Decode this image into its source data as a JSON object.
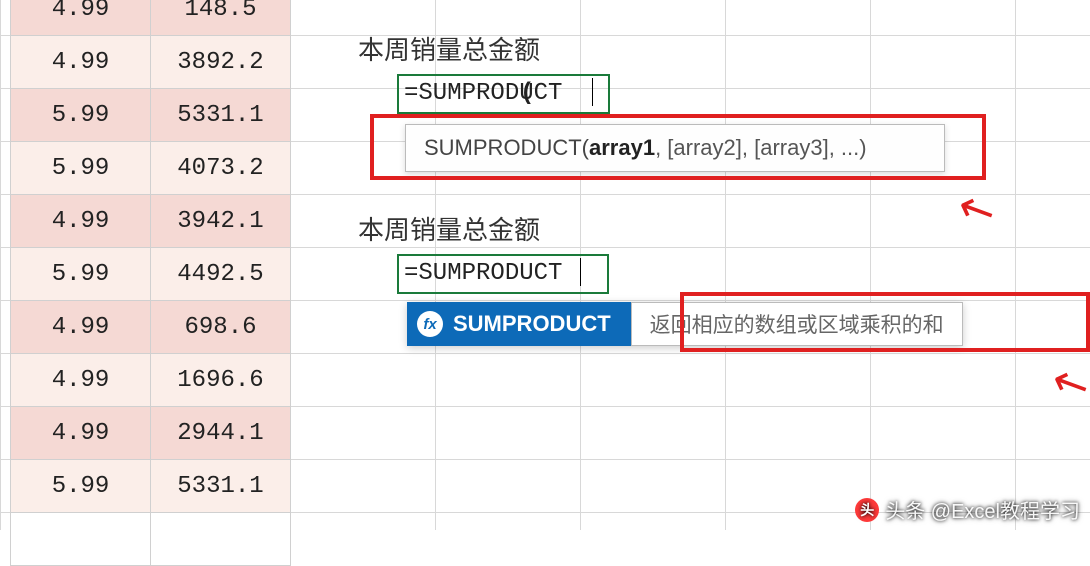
{
  "table": {
    "rows": [
      {
        "c1": "4.99",
        "c2": "148.5"
      },
      {
        "c1": "4.99",
        "c2": "3892.2"
      },
      {
        "c1": "5.99",
        "c2": "5331.1"
      },
      {
        "c1": "5.99",
        "c2": "4073.2"
      },
      {
        "c1": "4.99",
        "c2": "3942.1"
      },
      {
        "c1": "5.99",
        "c2": "4492.5"
      },
      {
        "c1": "4.99",
        "c2": "698.6"
      },
      {
        "c1": "4.99",
        "c2": "1696.6"
      },
      {
        "c1": "4.99",
        "c2": "2944.1"
      },
      {
        "c1": "5.99",
        "c2": "5331.1"
      }
    ]
  },
  "section1": {
    "label": "本周销量总金额",
    "formula_prefix": "=SUMPRODUCT",
    "formula_paren": "(",
    "tooltip_fn": "SUMPRODUCT(",
    "tooltip_arg1": "array1",
    "tooltip_rest": ", [array2], [array3], ...)"
  },
  "section2": {
    "label": "本周销量总金额",
    "formula": "=SUMPRODUCT",
    "autocomplete_item": "SUMPRODUCT",
    "autocomplete_desc": "返回相应的数组或区域乘积的和",
    "fx_glyph": "fx"
  },
  "watermark": {
    "logo_glyph": "头",
    "text": "头条 @Excel教程学习"
  },
  "colors": {
    "highlight_border": "#e02020",
    "cell_edit_border": "#1a7a3a",
    "autocomplete_bg": "#0d6ab8"
  }
}
